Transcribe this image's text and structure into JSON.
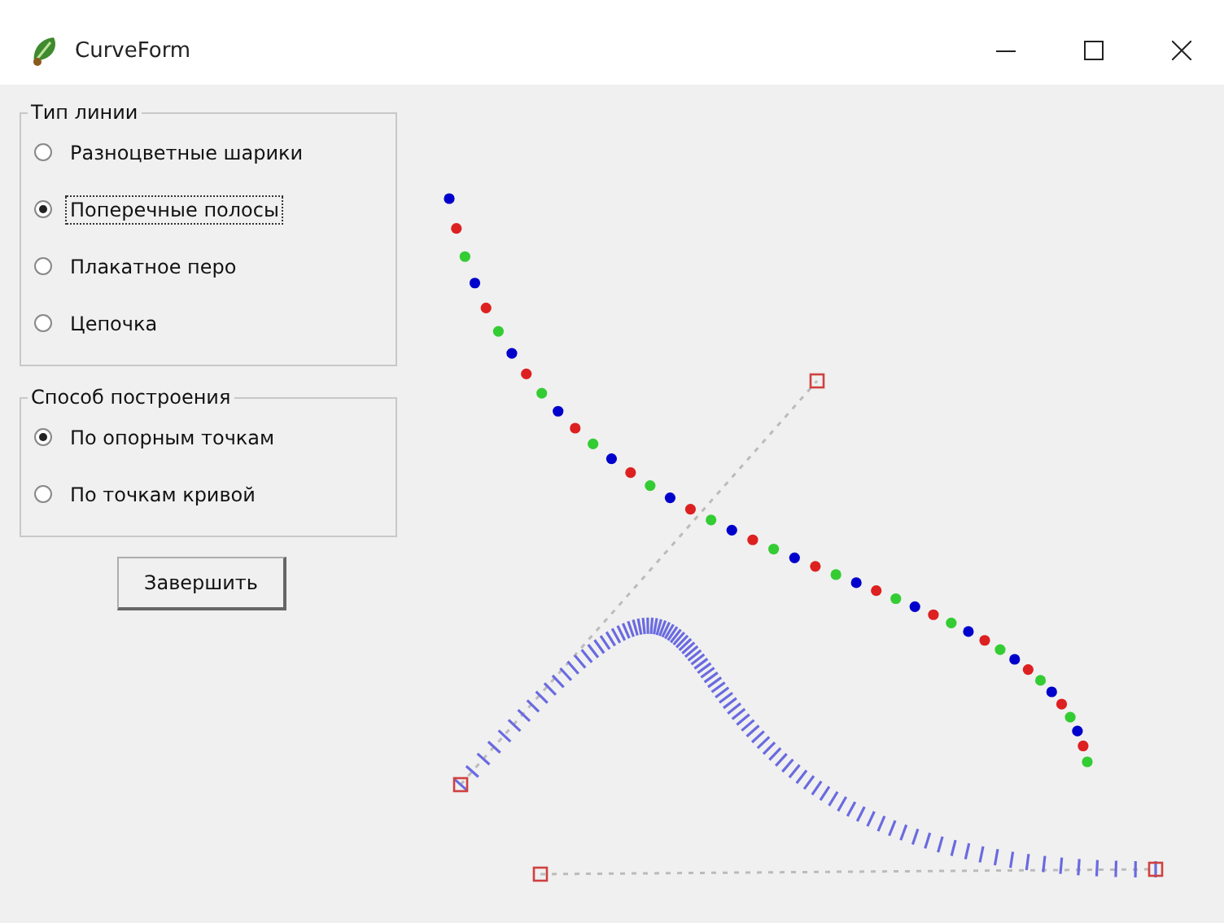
{
  "window": {
    "title": "CurveForm"
  },
  "groups": [
    {
      "legend": "Тип линии",
      "options": [
        {
          "label": "Разноцветные шарики",
          "selected": false,
          "focused": false
        },
        {
          "label": "Поперечные полосы",
          "selected": true,
          "focused": true
        },
        {
          "label": "Плакатное перо",
          "selected": false,
          "focused": false
        },
        {
          "label": "Цепочка",
          "selected": false,
          "focused": false
        }
      ]
    },
    {
      "legend": "Способ построения",
      "options": [
        {
          "label": "По опорным точкам",
          "selected": true,
          "focused": false
        },
        {
          "label": "По точкам кривой",
          "selected": false,
          "focused": false
        }
      ]
    }
  ],
  "button": "Завершить"
}
